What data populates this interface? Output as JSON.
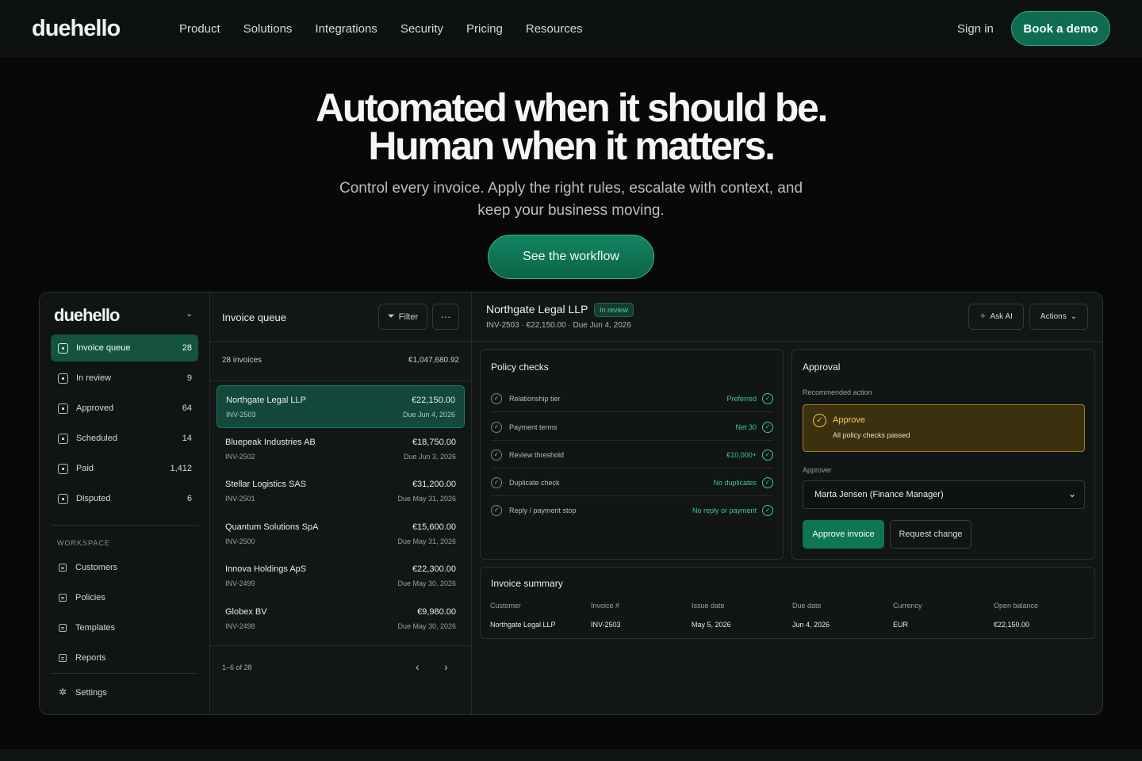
{
  "nav": {
    "logo": "duehello",
    "links": [
      "Product",
      "Solutions",
      "Integrations",
      "Security",
      "Pricing",
      "Resources"
    ],
    "sign_in": "Sign in",
    "cta": "Book a demo"
  },
  "hero": {
    "title_line1": "Automated when it should be.",
    "title_line2": "Human when it matters.",
    "subtitle": "Control every invoice. Apply the right rules, escalate with context, and keep your business moving.",
    "cta": "See the workflow"
  },
  "sidebar": {
    "logo": "duehello",
    "items": [
      {
        "label": "Invoice queue",
        "count": "28"
      },
      {
        "label": "In review",
        "count": "9"
      },
      {
        "label": "Approved",
        "count": "64"
      },
      {
        "label": "Scheduled",
        "count": "14"
      },
      {
        "label": "Paid",
        "count": "1,412"
      },
      {
        "label": "Disputed",
        "count": "6"
      }
    ],
    "workspace_title": "WORKSPACE",
    "workspace": [
      "Customers",
      "Policies",
      "Templates",
      "Reports"
    ],
    "settings": "Settings"
  },
  "queue": {
    "title": "Invoice queue",
    "filter": "Filter",
    "more": "···",
    "count": "28 invoices",
    "total": "€1,047,680.92",
    "invoices": [
      {
        "name": "Northgate Legal LLP",
        "id": "INV-2503",
        "amount": "€22,150.00",
        "due": "Due Jun 4, 2026"
      },
      {
        "name": "Bluepeak Industries AB",
        "id": "INV-2502",
        "amount": "€18,750.00",
        "due": "Due Jun 3, 2026"
      },
      {
        "name": "Stellar Logistics SAS",
        "id": "INV-2501",
        "amount": "€31,200.00",
        "due": "Due May 31, 2026"
      },
      {
        "name": "Quantum Solutions SpA",
        "id": "INV-2500",
        "amount": "€15,600.00",
        "due": "Due May 31, 2026"
      },
      {
        "name": "Innova Holdings ApS",
        "id": "INV-2499",
        "amount": "€22,300.00",
        "due": "Due May 30, 2026"
      },
      {
        "name": "Globex BV",
        "id": "INV-2498",
        "amount": "€9,980.00",
        "due": "Due May 30, 2026"
      }
    ],
    "pager": "1–6 of 28",
    "prev": "‹",
    "next": "›"
  },
  "detail": {
    "title": "Northgate Legal LLP",
    "status": "In review",
    "meta": "INV-2503 · €22,150.00 · Due Jun 4, 2026",
    "ask_ai": "Ask AI",
    "actions": "Actions",
    "policy": {
      "title": "Policy checks",
      "checks": [
        {
          "label": "Relationship tier",
          "value": "Preferred"
        },
        {
          "label": "Payment terms",
          "value": "Net 30"
        },
        {
          "label": "Review threshold",
          "value": "€10,000+"
        },
        {
          "label": "Duplicate check",
          "value": "No duplicates"
        },
        {
          "label": "Reply / payment stop",
          "value": "No reply or payment"
        }
      ]
    },
    "approval": {
      "title": "Approval",
      "recommended_label": "Recommended action",
      "recommended_title": "Approve",
      "recommended_sub": "All policy checks passed",
      "approver_label": "Approver",
      "approver_value": "Marta Jensen (Finance Manager)",
      "approve_btn": "Approve invoice",
      "change_btn": "Request change"
    },
    "summary": {
      "title": "Invoice summary",
      "columns": [
        {
          "head": "Customer",
          "value": "Northgate Legal LLP"
        },
        {
          "head": "Invoice #",
          "value": "INV-2503"
        },
        {
          "head": "Issue date",
          "value": "May 5, 2026"
        },
        {
          "head": "Due date",
          "value": "Jun 4, 2026"
        },
        {
          "head": "Currency",
          "value": "EUR"
        },
        {
          "head": "Open balance",
          "value": "€22,150.00"
        }
      ]
    }
  },
  "colors": {
    "accent": "#0f7655",
    "accent_text": "#3ccb8f",
    "warning": "#e9c54a",
    "background": "#070807"
  }
}
